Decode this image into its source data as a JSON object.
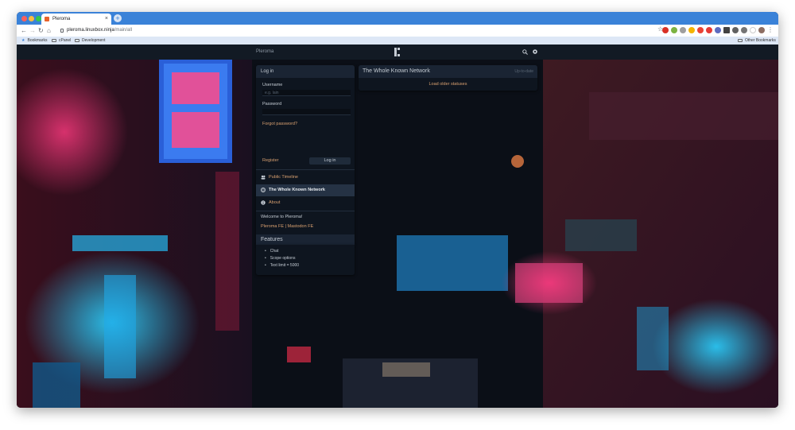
{
  "browser": {
    "tab_title": "Pleroma",
    "tab_close": "×",
    "new_tab": "+",
    "url_host": "pleroma.linuxbox.ninja",
    "url_path": "/main/all",
    "bookmarks": [
      {
        "label": "Bookmarks",
        "icon": "star-icon"
      },
      {
        "label": "cPanel",
        "icon": "folder-icon"
      },
      {
        "label": "Development",
        "icon": "folder-icon"
      }
    ],
    "other_bookmarks": "Other Bookmarks"
  },
  "navbar": {
    "site_name": "Pleroma"
  },
  "login": {
    "heading": "Log in",
    "username_label": "Username",
    "username_placeholder": "e.g. lain",
    "password_label": "Password",
    "forgot_password": "Forgot password?",
    "register": "Register",
    "login_button": "Log in"
  },
  "nav": {
    "items": [
      {
        "label": "Public Timeline",
        "icon": "users-icon",
        "active": false
      },
      {
        "label": "The Whole Known Network",
        "icon": "globe-icon",
        "active": true
      },
      {
        "label": "About",
        "icon": "info-icon",
        "active": false
      }
    ]
  },
  "instance": {
    "welcome": "Welcome to Pleroma!",
    "links": "Pleroma FE | Mastodon FE"
  },
  "features": {
    "heading": "Features",
    "items": [
      "Chat",
      "Scope options",
      "Text limit = 5000"
    ]
  },
  "timeline": {
    "title": "The Whole Known Network",
    "status": "Up-to-date",
    "load_older": "Load older statuses"
  },
  "colors": {
    "accent_link": "#d8a070",
    "panel_bg": "#0f1620",
    "chrome_blue": "#3a82d8"
  }
}
